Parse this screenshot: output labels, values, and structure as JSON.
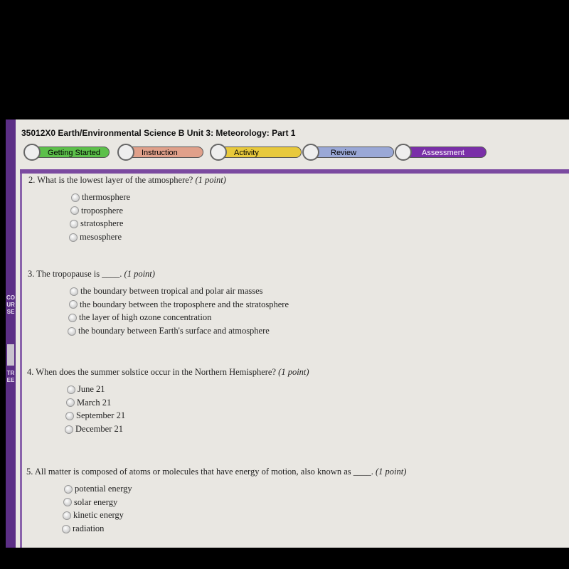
{
  "course_title": "35012X0 Earth/Environmental Science B  Unit 3: Meteorology: Part 1",
  "course_tree": {
    "label_top": "COURSE",
    "label_bottom": "TREE"
  },
  "tabs": [
    {
      "label": "Getting Started",
      "color": "#5cc04a",
      "icon": "traffic-light-icon"
    },
    {
      "label": "Instruction",
      "color": "#e0a08a",
      "icon": "page-icon"
    },
    {
      "label": "Activity",
      "color": "#e8c93c",
      "icon": "books-icon"
    },
    {
      "label": "Review",
      "color": "#9aa8d6",
      "icon": "review-icon"
    },
    {
      "label": "Assessment",
      "color": "#7a2fa8",
      "icon": "clipboard-icon"
    }
  ],
  "questions": [
    {
      "number": "2.",
      "text": "What is the lowest layer of the atmosphere?",
      "points": "(1 point)",
      "options": [
        "thermosphere",
        "troposphere",
        "stratosphere",
        "mesosphere"
      ]
    },
    {
      "number": "3.",
      "text": "The tropopause is ____.",
      "points": "(1 point)",
      "options": [
        "the boundary between tropical and polar air masses",
        "the boundary between the troposphere and the stratosphere",
        "the layer of high ozone concentration",
        "the boundary between Earth's surface and atmosphere"
      ]
    },
    {
      "number": "4.",
      "text": "When does the summer solstice occur in the Northern Hemisphere?",
      "points": "(1 point)",
      "options": [
        "June 21",
        "March 21",
        "September 21",
        "December 21"
      ]
    },
    {
      "number": "5.",
      "text": "All matter is composed of atoms or molecules that have energy of motion, also known as ____.",
      "points": "(1 point)",
      "options": [
        "potential energy",
        "solar energy",
        "kinetic energy",
        "radiation"
      ]
    }
  ]
}
